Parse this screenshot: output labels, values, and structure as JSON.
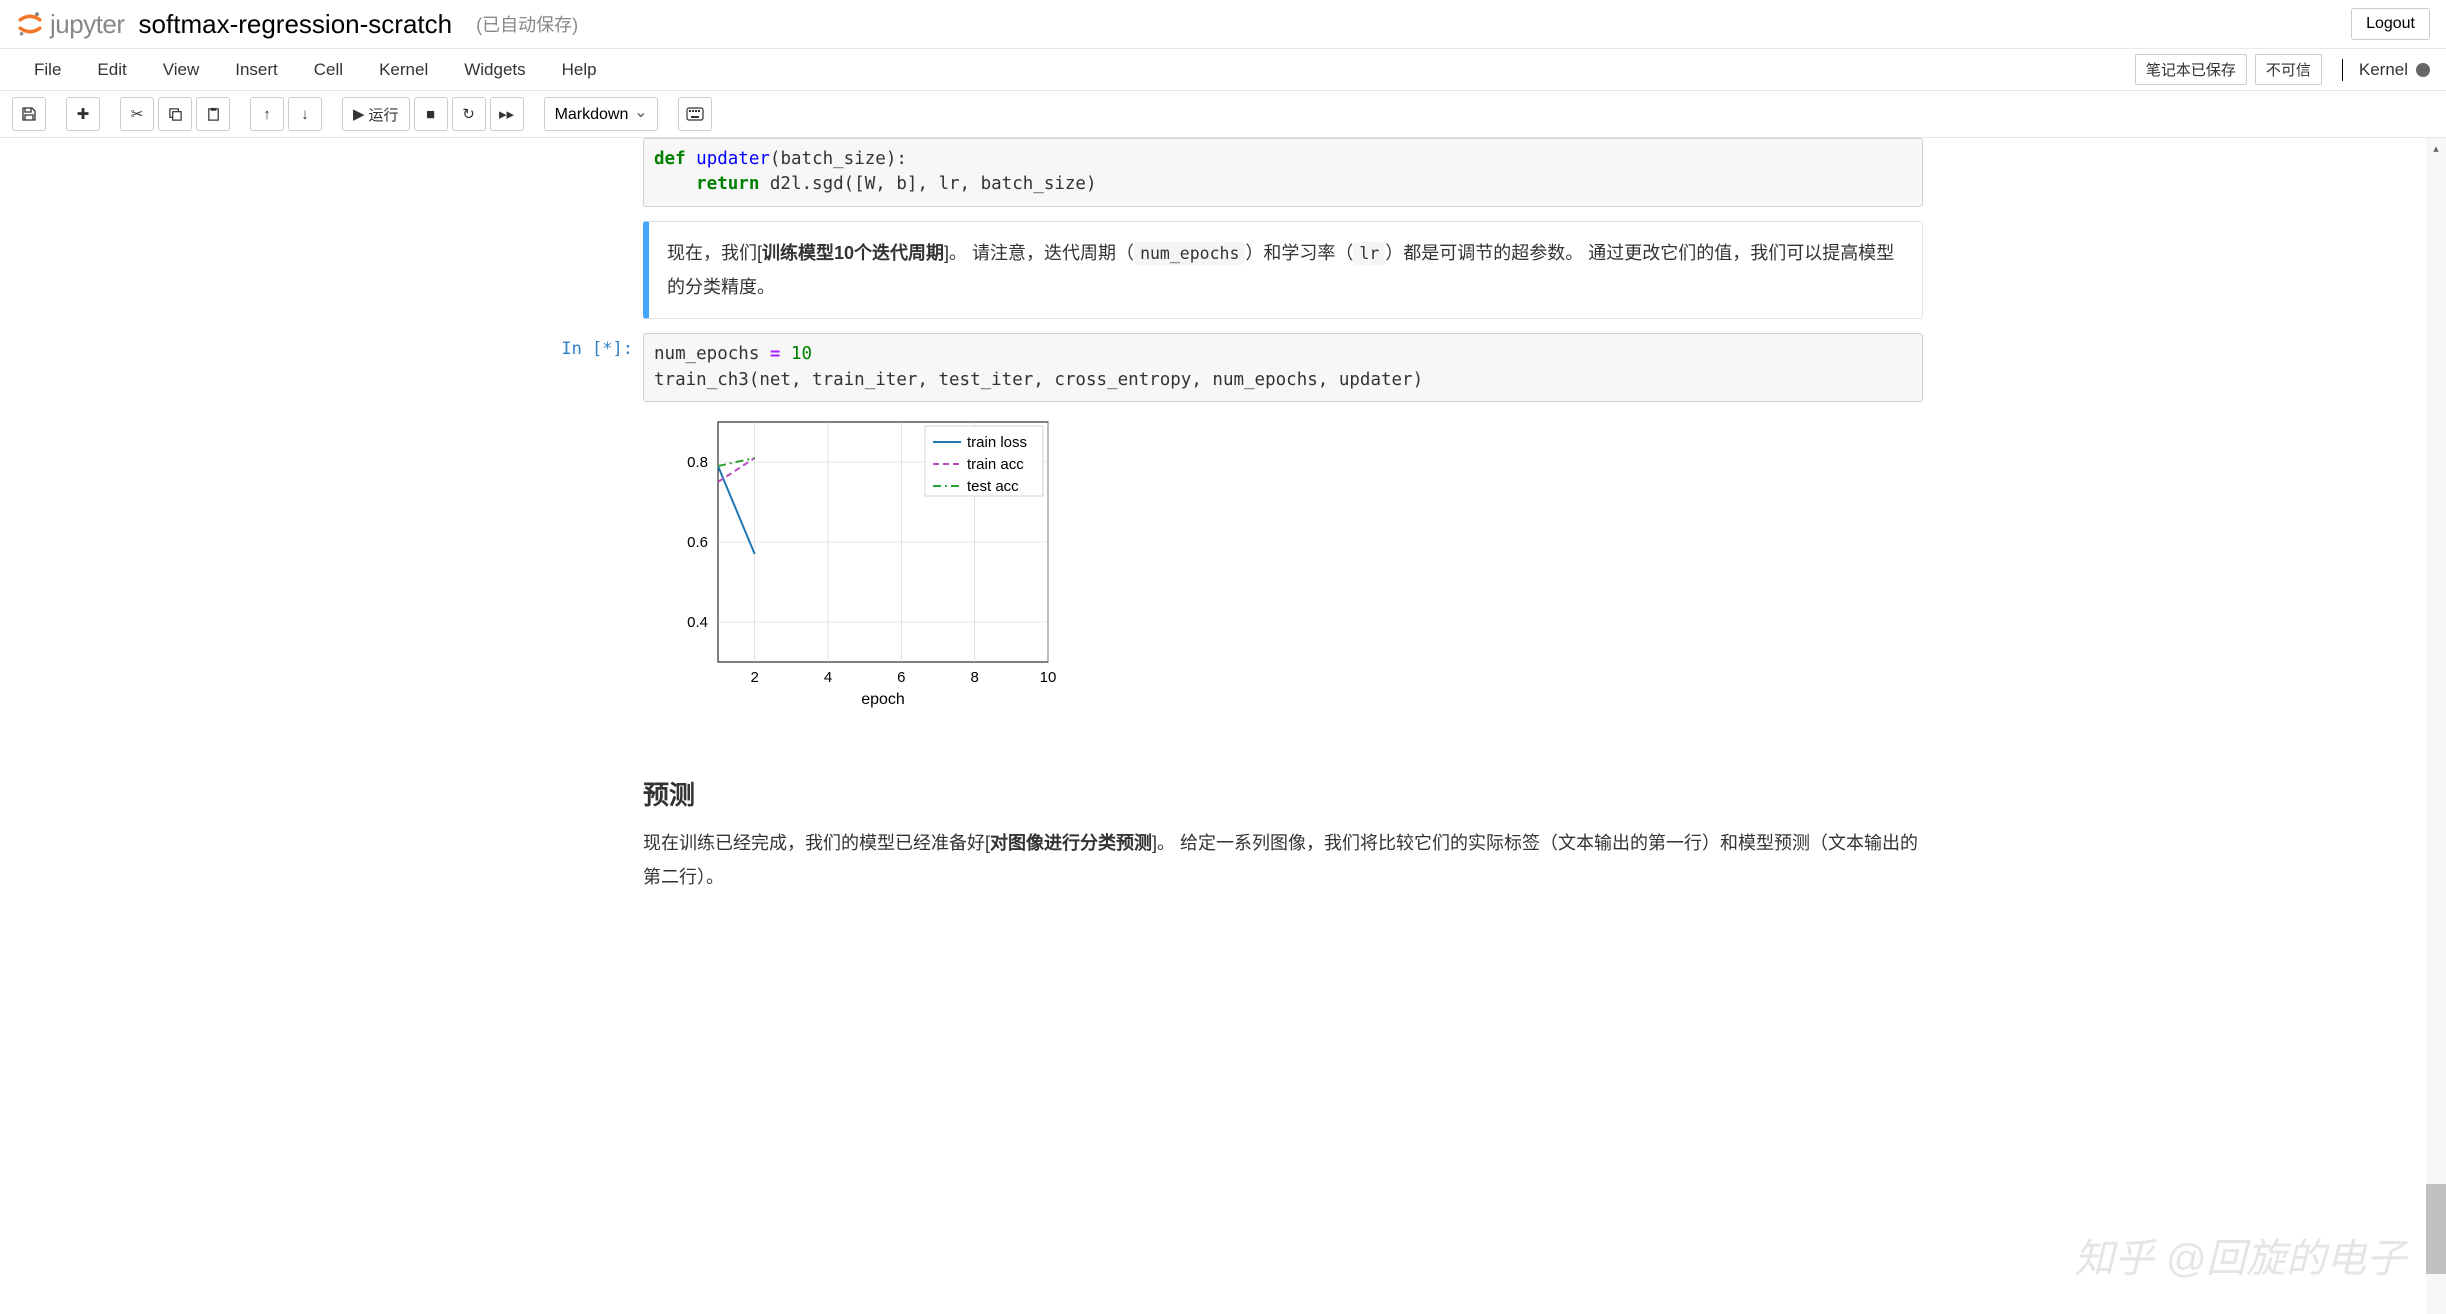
{
  "header": {
    "logo_text": "jupyter",
    "notebook_name": "softmax-regression-scratch",
    "autosave": "(已自动保存)",
    "logout": "Logout"
  },
  "menu": {
    "items": [
      "File",
      "Edit",
      "View",
      "Insert",
      "Cell",
      "Kernel",
      "Widgets",
      "Help"
    ],
    "save_status": "笔记本已保存",
    "trust_status": "不可信",
    "kernel_label": "Kernel"
  },
  "toolbar": {
    "run_label": "运行",
    "cell_type": "Markdown"
  },
  "cells": {
    "code1_line1": "def ",
    "code1_fn": "updater",
    "code1_rest1": "(batch_size):",
    "code1_line2_kw": "    return",
    "code1_line2_rest": " d2l.sgd([W, b], lr, batch_size)",
    "md1_a": "现在，我们[",
    "md1_b": "训练模型10个迭代周期",
    "md1_c": "]。 请注意，迭代周期（",
    "md1_code1": "num_epochs",
    "md1_d": "）和学习率（",
    "md1_code2": "lr",
    "md1_e": "）都是可调节的超参数。 通过更改它们的值，我们可以提高模型的分类精度。",
    "prompt2": "In  [*]:",
    "code2_a": "num_epochs ",
    "code2_op": "=",
    "code2_num": " 10",
    "code2_line2": "train_ch3(net, train_iter, test_iter, cross_entropy, num_epochs, updater)",
    "heading": "预测",
    "md2_a": "现在训练已经完成，我们的模型已经准备好[",
    "md2_b": "对图像进行分类预测",
    "md2_c": "]。 给定一系列图像，我们将比较它们的实际标签（文本输出的第一行）和模型预测（文本输出的第二行）。"
  },
  "chart_data": {
    "type": "line",
    "xlabel": "epoch",
    "ylabel": "",
    "xlim": [
      1,
      10
    ],
    "ylim": [
      0.3,
      0.9
    ],
    "xticks": [
      2,
      4,
      6,
      8,
      10
    ],
    "yticks": [
      0.4,
      0.6,
      0.8
    ],
    "series": [
      {
        "name": "train loss",
        "color": "#1f77b4",
        "dash": "solid",
        "x": [
          1,
          2
        ],
        "y": [
          0.79,
          0.57
        ]
      },
      {
        "name": "train acc",
        "color": "#bc4bbd",
        "dash": "dashed",
        "x": [
          1,
          2
        ],
        "y": [
          0.75,
          0.81
        ]
      },
      {
        "name": "test acc",
        "color": "#2ca02c",
        "dash": "dashdot",
        "x": [
          1,
          2
        ],
        "y": [
          0.79,
          0.81
        ]
      }
    ],
    "legend_pos": "upper right"
  },
  "watermark": "知乎 @回旋的电子"
}
